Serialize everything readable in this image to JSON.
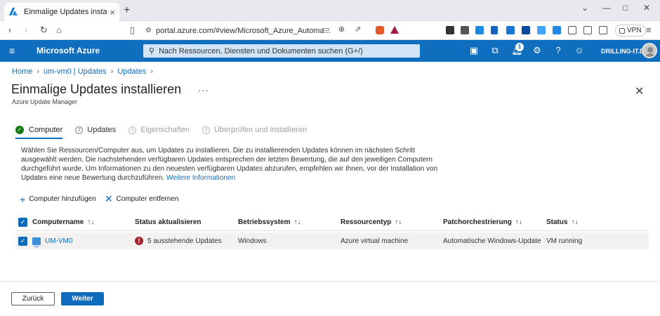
{
  "browser": {
    "tab_title": "Einmalige Updates installieren ·",
    "url": "portal.azure.com/#view/Microsoft_Azure_Automa...",
    "vpn_label": "VPN"
  },
  "azure": {
    "brand": "Microsoft Azure",
    "search_placeholder": "Nach Ressourcen, Diensten und Dokumenten suchen (G+/)",
    "notification_count": "1",
    "tenant": "DRILLING-IT.DE"
  },
  "breadcrumb": [
    "Home",
    "um-vm0 | Updates",
    "Updates"
  ],
  "page": {
    "title": "Einmalige Updates installieren",
    "subtitle": "Azure Update Manager"
  },
  "steps": [
    {
      "num": "",
      "label": "Computer",
      "state": "active"
    },
    {
      "num": "2",
      "label": "Updates",
      "state": "normal"
    },
    {
      "num": "3",
      "label": "Eigenschaften",
      "state": "dim"
    },
    {
      "num": "4",
      "label": "Überprüfen und installieren",
      "state": "dim"
    }
  ],
  "description": {
    "text": "Wählen Sie Ressourcen/Computer aus, um Updates zu installieren. Die zu installierenden Updates können im nächsten Schritt ausgewählt werden. Die nachstehenden verfügbaren Updates entsprechen der letzten Bewertung, die auf den jeweiligen Computern durchgeführt wurde. Um Informationen zu den neuesten verfügbaren Updates abzurufen, empfehlen wir Ihnen, vor der Installation von Updates eine neue Bewertung durchzuführen.",
    "link": "Weitere Informationen"
  },
  "toolbar": {
    "add_label": "Computer hinzufügen",
    "remove_label": "Computer entfernen"
  },
  "table": {
    "columns": [
      "Computername",
      "Status aktualisieren",
      "Betriebssystem",
      "Ressourcentyp",
      "Patchorchestrierung",
      "Status"
    ],
    "rows": [
      {
        "name": "UM-VM0",
        "update_status": "5 ausstehende Updates",
        "os": "Windows",
        "type": "Azure virtual machine",
        "patch": "Automatische Windows-Update",
        "status": "VM running"
      }
    ]
  },
  "footer": {
    "back_label": "Zurück",
    "next_label": "Weiter"
  },
  "colors": {
    "azure_blue": "#106ebe",
    "link_blue": "#0f6cbd",
    "success_green": "#107c10",
    "error_red": "#a4262c"
  }
}
